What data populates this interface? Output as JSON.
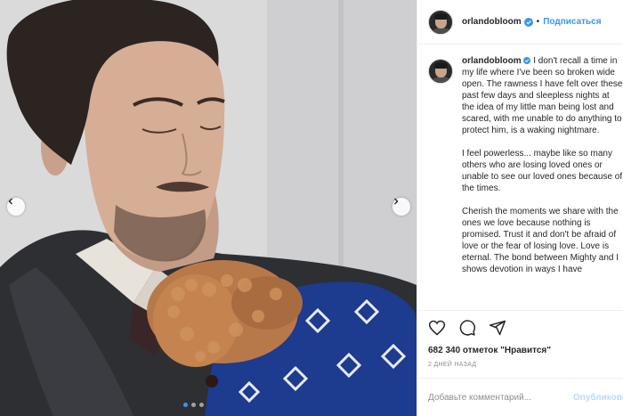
{
  "post": {
    "username": "orlandobloom",
    "follow_label": "Подписаться",
    "separator": "•",
    "caption_paragraphs": [
      "I don't recall a time in my life where I've been so broken wide open. The rawness I have felt over these past few days and sleepless nights at the idea of my little man being lost and scared, with me unable to do anything to protect him, is a waking nightmare.",
      "I feel powerless... maybe like so many others who are losing loved ones or unable to see our loved ones because of the times.",
      "Cherish the moments we share with the ones we love because nothing is promised. Trust it and don't be afraid of love or the fear of losing love. Love is eternal. The bond between Mighty and I shows devotion in ways I have"
    ],
    "likes_text": "682 340 отметок \"Нравится\"",
    "date_text": "2 ДНЕЙ НАЗАД",
    "comment_placeholder": "Добавьте комментарий...",
    "post_button": "Опубликовать"
  },
  "icons": {
    "like": "heart-icon",
    "comment": "comment-icon",
    "share": "share-icon",
    "verified": "verified-badge-icon",
    "prev": "chevron-left-icon",
    "next": "chevron-right-icon"
  },
  "carousel": {
    "count": 3,
    "active_index": 0
  },
  "colors": {
    "link": "#3897f0",
    "post_button_disabled": "#b3dbff",
    "muted": "#8e8e8e",
    "border": "#efefef",
    "blanket": "#1d3b8f"
  }
}
